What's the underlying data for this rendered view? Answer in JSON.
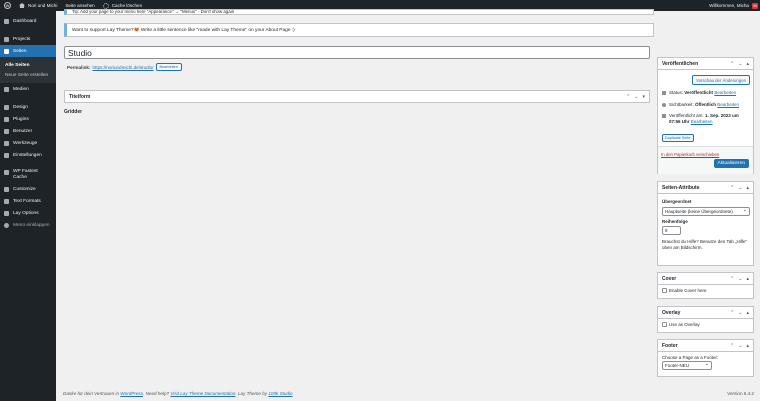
{
  "adminbar": {
    "site_name": "Nori und Michi",
    "view_page": "Seite ansehen",
    "cache": "Cache löschen",
    "greeting": "Willkommen, Micha",
    "avatar_letter": "M"
  },
  "sidebar": {
    "items": [
      {
        "label": "Dashboard"
      },
      {
        "label": "Projects"
      },
      {
        "label": "Seiten"
      },
      {
        "label": "Medien"
      },
      {
        "label": "Design"
      },
      {
        "label": "Plugins"
      },
      {
        "label": "Benutzer"
      },
      {
        "label": "Werkzeuge"
      },
      {
        "label": "Einstellungen"
      },
      {
        "label": "WP Fastest Cache"
      },
      {
        "label": "Customize"
      },
      {
        "label": "Text Formats"
      },
      {
        "label": "Lay Options"
      },
      {
        "label": "Menü einklappen"
      }
    ],
    "submenu": [
      "Alle Seiten",
      "Neue Seite erstellen"
    ]
  },
  "notices": {
    "top": "Tip: Add your page to your menu here \"Appearance\" → \"Menus\" · Don't show again",
    "support": "Want to support Lay Theme?😻 Write a little sentence like \"made with Lay Theme\" on your About Page :)"
  },
  "editor": {
    "title": "Studio",
    "permalink_label": "Permalink:",
    "permalink_url": "https://noriundmichi.de/studio/",
    "edit_button": "Bearbeiten",
    "titleform_heading": "Titelform",
    "gridder_label": "Gridder"
  },
  "publish": {
    "heading": "Veröffentlichen",
    "preview_button": "Vorschau der Änderungen",
    "status_label": "Status:",
    "status_value": "Veröffentlicht",
    "status_edit": "Bearbeiten",
    "visibility_label": "Sichtbarkeit:",
    "visibility_value": "Öffentlich",
    "visibility_edit": "Bearbeiten",
    "published_label": "Veröffentlicht am:",
    "published_value": "1. Sep. 2023 um 07:56 Uhr",
    "published_edit": "Bearbeiten",
    "duplicate_button": "Duplicate Seite",
    "trash_link": "In den Papierkorb verschieben",
    "update_button": "Aktualisieren"
  },
  "attributes": {
    "heading": "Seiten-Attribute",
    "parent_label": "Übergeordnet",
    "parent_value": "Hauptseite (keine Übergeordnete)",
    "order_label": "Reihenfolge",
    "order_value": "9",
    "help_text": "Brauchst du Hilfe? Benutze den Tab „Hilfe“ oben am Bildschirm."
  },
  "cover": {
    "heading": "Cover",
    "checkbox": "Enable Cover here"
  },
  "overlay": {
    "heading": "Overlay",
    "checkbox": "Use as Overlay"
  },
  "footer_box": {
    "heading": "Footer",
    "label": "Choose a Page as a Footer:",
    "value": "Footer-NEU"
  },
  "footer": {
    "thanks": "Danke für dein Vertrauen in",
    "wordpress": "WordPress",
    "help": ". Need help?",
    "docs": "Visit Lay Theme Documentation",
    "by": ". Lay Theme by",
    "studio": "100k Studio",
    "version": "Version 6.4.2"
  }
}
